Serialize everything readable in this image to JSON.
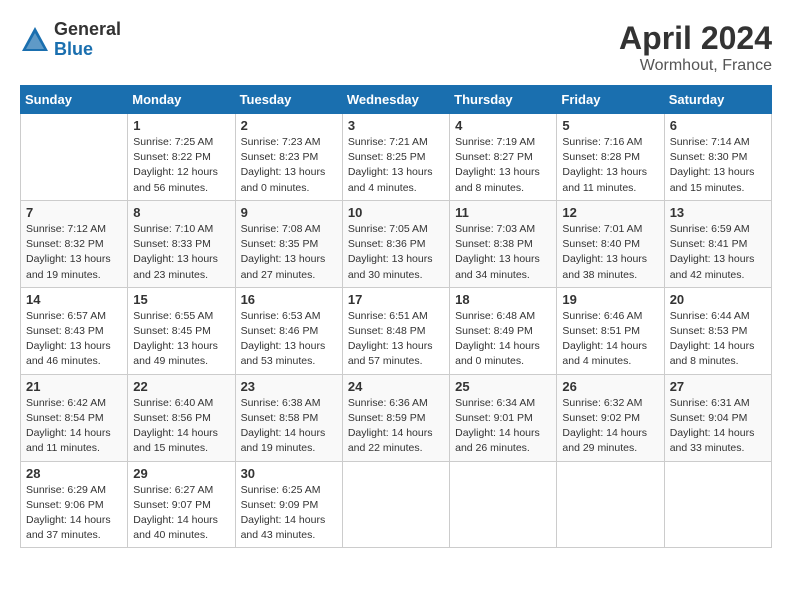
{
  "logo": {
    "general": "General",
    "blue": "Blue"
  },
  "title": {
    "month_year": "April 2024",
    "location": "Wormhout, France"
  },
  "headers": [
    "Sunday",
    "Monday",
    "Tuesday",
    "Wednesday",
    "Thursday",
    "Friday",
    "Saturday"
  ],
  "weeks": [
    [
      {
        "day": "",
        "info": ""
      },
      {
        "day": "1",
        "info": "Sunrise: 7:25 AM\nSunset: 8:22 PM\nDaylight: 12 hours\nand 56 minutes."
      },
      {
        "day": "2",
        "info": "Sunrise: 7:23 AM\nSunset: 8:23 PM\nDaylight: 13 hours\nand 0 minutes."
      },
      {
        "day": "3",
        "info": "Sunrise: 7:21 AM\nSunset: 8:25 PM\nDaylight: 13 hours\nand 4 minutes."
      },
      {
        "day": "4",
        "info": "Sunrise: 7:19 AM\nSunset: 8:27 PM\nDaylight: 13 hours\nand 8 minutes."
      },
      {
        "day": "5",
        "info": "Sunrise: 7:16 AM\nSunset: 8:28 PM\nDaylight: 13 hours\nand 11 minutes."
      },
      {
        "day": "6",
        "info": "Sunrise: 7:14 AM\nSunset: 8:30 PM\nDaylight: 13 hours\nand 15 minutes."
      }
    ],
    [
      {
        "day": "7",
        "info": "Sunrise: 7:12 AM\nSunset: 8:32 PM\nDaylight: 13 hours\nand 19 minutes."
      },
      {
        "day": "8",
        "info": "Sunrise: 7:10 AM\nSunset: 8:33 PM\nDaylight: 13 hours\nand 23 minutes."
      },
      {
        "day": "9",
        "info": "Sunrise: 7:08 AM\nSunset: 8:35 PM\nDaylight: 13 hours\nand 27 minutes."
      },
      {
        "day": "10",
        "info": "Sunrise: 7:05 AM\nSunset: 8:36 PM\nDaylight: 13 hours\nand 30 minutes."
      },
      {
        "day": "11",
        "info": "Sunrise: 7:03 AM\nSunset: 8:38 PM\nDaylight: 13 hours\nand 34 minutes."
      },
      {
        "day": "12",
        "info": "Sunrise: 7:01 AM\nSunset: 8:40 PM\nDaylight: 13 hours\nand 38 minutes."
      },
      {
        "day": "13",
        "info": "Sunrise: 6:59 AM\nSunset: 8:41 PM\nDaylight: 13 hours\nand 42 minutes."
      }
    ],
    [
      {
        "day": "14",
        "info": "Sunrise: 6:57 AM\nSunset: 8:43 PM\nDaylight: 13 hours\nand 46 minutes."
      },
      {
        "day": "15",
        "info": "Sunrise: 6:55 AM\nSunset: 8:45 PM\nDaylight: 13 hours\nand 49 minutes."
      },
      {
        "day": "16",
        "info": "Sunrise: 6:53 AM\nSunset: 8:46 PM\nDaylight: 13 hours\nand 53 minutes."
      },
      {
        "day": "17",
        "info": "Sunrise: 6:51 AM\nSunset: 8:48 PM\nDaylight: 13 hours\nand 57 minutes."
      },
      {
        "day": "18",
        "info": "Sunrise: 6:48 AM\nSunset: 8:49 PM\nDaylight: 14 hours\nand 0 minutes."
      },
      {
        "day": "19",
        "info": "Sunrise: 6:46 AM\nSunset: 8:51 PM\nDaylight: 14 hours\nand 4 minutes."
      },
      {
        "day": "20",
        "info": "Sunrise: 6:44 AM\nSunset: 8:53 PM\nDaylight: 14 hours\nand 8 minutes."
      }
    ],
    [
      {
        "day": "21",
        "info": "Sunrise: 6:42 AM\nSunset: 8:54 PM\nDaylight: 14 hours\nand 11 minutes."
      },
      {
        "day": "22",
        "info": "Sunrise: 6:40 AM\nSunset: 8:56 PM\nDaylight: 14 hours\nand 15 minutes."
      },
      {
        "day": "23",
        "info": "Sunrise: 6:38 AM\nSunset: 8:58 PM\nDaylight: 14 hours\nand 19 minutes."
      },
      {
        "day": "24",
        "info": "Sunrise: 6:36 AM\nSunset: 8:59 PM\nDaylight: 14 hours\nand 22 minutes."
      },
      {
        "day": "25",
        "info": "Sunrise: 6:34 AM\nSunset: 9:01 PM\nDaylight: 14 hours\nand 26 minutes."
      },
      {
        "day": "26",
        "info": "Sunrise: 6:32 AM\nSunset: 9:02 PM\nDaylight: 14 hours\nand 29 minutes."
      },
      {
        "day": "27",
        "info": "Sunrise: 6:31 AM\nSunset: 9:04 PM\nDaylight: 14 hours\nand 33 minutes."
      }
    ],
    [
      {
        "day": "28",
        "info": "Sunrise: 6:29 AM\nSunset: 9:06 PM\nDaylight: 14 hours\nand 37 minutes."
      },
      {
        "day": "29",
        "info": "Sunrise: 6:27 AM\nSunset: 9:07 PM\nDaylight: 14 hours\nand 40 minutes."
      },
      {
        "day": "30",
        "info": "Sunrise: 6:25 AM\nSunset: 9:09 PM\nDaylight: 14 hours\nand 43 minutes."
      },
      {
        "day": "",
        "info": ""
      },
      {
        "day": "",
        "info": ""
      },
      {
        "day": "",
        "info": ""
      },
      {
        "day": "",
        "info": ""
      }
    ]
  ]
}
